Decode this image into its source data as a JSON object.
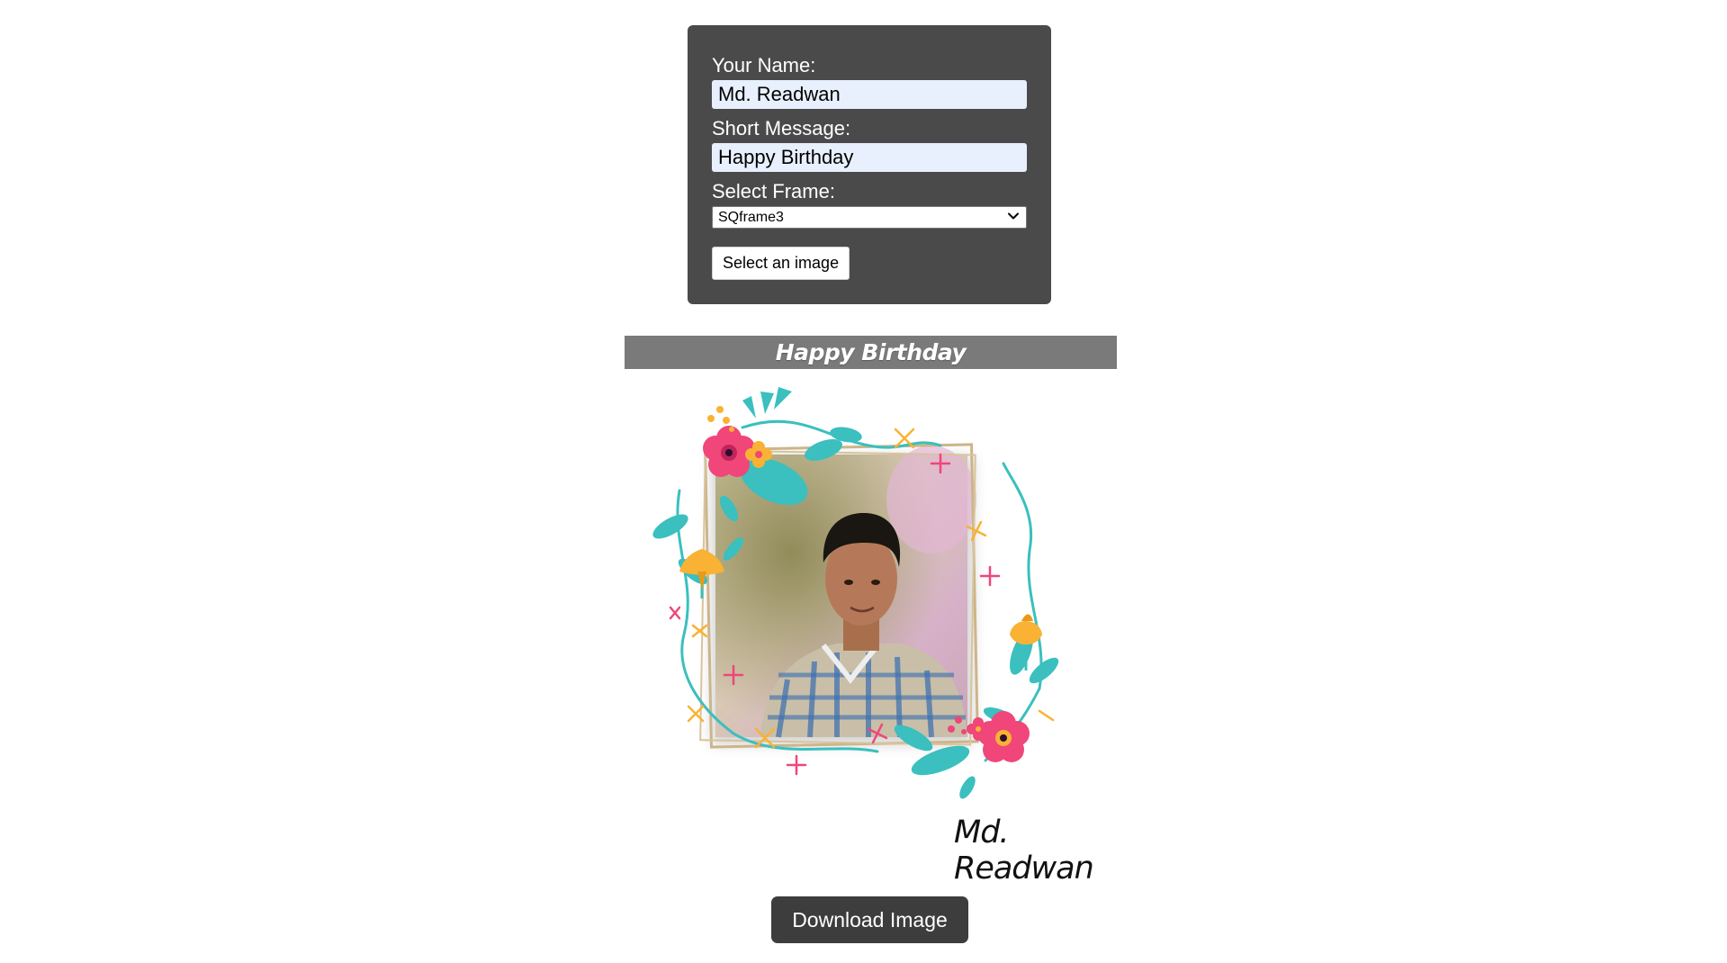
{
  "form": {
    "name_label": "Your Name:",
    "name_value": "Md. Readwan",
    "message_label": "Short Message:",
    "message_value": "Happy Birthday",
    "frame_label": "Select Frame:",
    "frame_selected": "SQframe3",
    "file_button_label": "Select an image"
  },
  "preview": {
    "message": "Happy Birthday",
    "name": "Md. Readwan",
    "photo_alt": "portrait-photo",
    "frame_name": "SQframe3"
  },
  "actions": {
    "download_label": "Download Image"
  },
  "colors": {
    "panel_bg": "#4a4a4a",
    "banner_bg": "#7a7a7a",
    "button_bg": "#3d3d3d",
    "input_bg": "#e8f0fe",
    "flower_pink": "#f0467a",
    "leaf_teal": "#3bbfbf",
    "flower_yellow": "#f9b233"
  },
  "icons": {
    "select_chevron": "chevron-down-icon"
  }
}
